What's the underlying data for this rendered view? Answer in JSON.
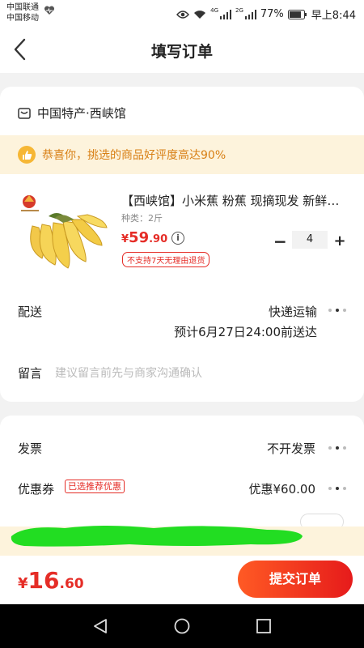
{
  "status_bar": {
    "carrier1": "中国联通",
    "carrier2": "中国移动",
    "net1": "4G",
    "net2": "2G",
    "battery": "77%",
    "time": "早上8:44"
  },
  "header": {
    "title": "填写订单"
  },
  "shop": {
    "name": "中国特产·西峡馆"
  },
  "promo": {
    "text": "恭喜你，挑选的商品好评度高达90%"
  },
  "product": {
    "title": "【西峡馆】小米蕉 粉蕉 现摘现发 新鲜水果",
    "spec": "种类：2斤",
    "price_symbol": "¥",
    "price_int": "59",
    "price_dec": ".90",
    "badge": "不支持7天无理由退货",
    "quantity": "4"
  },
  "delivery": {
    "label": "配送",
    "method": "快递运输",
    "eta": "预计6月27日24:00前送达"
  },
  "note": {
    "label": "留言",
    "placeholder": "建议留言前先与商家沟通确认"
  },
  "invoice": {
    "label": "发票",
    "value": "不开发票"
  },
  "coupon": {
    "label": "优惠券",
    "tag": "已选推荐优惠",
    "value": "优惠¥60.00"
  },
  "footer": {
    "total_symbol": "¥",
    "total_int": "16",
    "total_dec": ".60",
    "submit_label": "提交订单"
  },
  "colors": {
    "accent": "#e52d27",
    "promo_bg": "#fdf3dc",
    "promo_text": "#d87f14",
    "redaction": "#22dd22"
  }
}
